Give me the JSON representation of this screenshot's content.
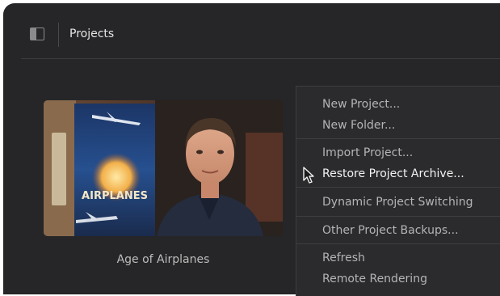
{
  "header": {
    "title": "Projects",
    "sidebar_icon": "sidebar-toggle-icon"
  },
  "project": {
    "name": "Age of Airplanes",
    "thumbnail_poster_text": "AIRPLANES"
  },
  "context_menu": {
    "items": [
      {
        "label": "New Project..."
      },
      {
        "label": "New Folder..."
      },
      {
        "label": "Import Project..."
      },
      {
        "label": "Restore Project Archive..."
      },
      {
        "label": "Dynamic Project Switching"
      },
      {
        "label": "Other Project Backups..."
      },
      {
        "label": "Refresh"
      },
      {
        "label": "Remote Rendering"
      }
    ],
    "highlighted_index": 3
  },
  "colors": {
    "background": "#262628",
    "menu_background": "#2b2b2d",
    "menu_text": "#b4b4b6",
    "menu_text_highlight": "#f2f2f2"
  }
}
